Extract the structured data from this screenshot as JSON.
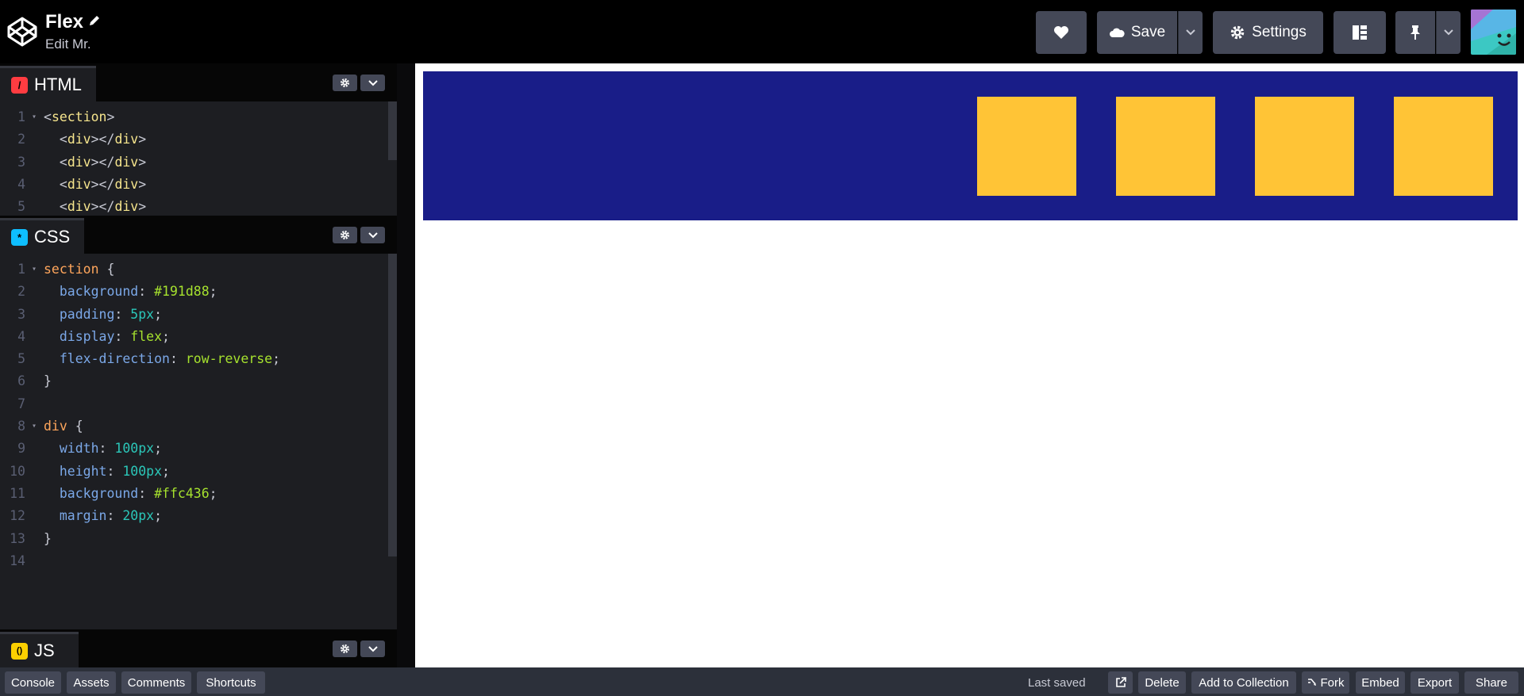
{
  "header": {
    "title": "Flex",
    "subtitle": "Edit Mr.",
    "save_label": "Save",
    "settings_label": "Settings"
  },
  "panels": {
    "html": {
      "label": "HTML",
      "badge": "/",
      "badge_color": "#ff3c41"
    },
    "css": {
      "label": "CSS",
      "badge": "*",
      "badge_color": "#0ebeff"
    },
    "js": {
      "label": "JS",
      "badge": "()",
      "badge_color": "#fcd000"
    }
  },
  "html_code": [
    {
      "n": "1",
      "fold": true,
      "parts": [
        [
          "t-ang",
          "<"
        ],
        [
          "t-tag",
          "section"
        ],
        [
          "t-ang",
          ">"
        ]
      ]
    },
    {
      "n": "2",
      "fold": false,
      "parts": [
        [
          "t-ang",
          "  <"
        ],
        [
          "t-tag",
          "div"
        ],
        [
          "t-ang",
          "></"
        ],
        [
          "t-tag",
          "div"
        ],
        [
          "t-ang",
          ">"
        ]
      ]
    },
    {
      "n": "3",
      "fold": false,
      "parts": [
        [
          "t-ang",
          "  <"
        ],
        [
          "t-tag",
          "div"
        ],
        [
          "t-ang",
          "></"
        ],
        [
          "t-tag",
          "div"
        ],
        [
          "t-ang",
          ">"
        ]
      ]
    },
    {
      "n": "4",
      "fold": false,
      "parts": [
        [
          "t-ang",
          "  <"
        ],
        [
          "t-tag",
          "div"
        ],
        [
          "t-ang",
          "></"
        ],
        [
          "t-tag",
          "div"
        ],
        [
          "t-ang",
          ">"
        ]
      ]
    },
    {
      "n": "5",
      "fold": false,
      "parts": [
        [
          "t-ang",
          "  <"
        ],
        [
          "t-tag",
          "div"
        ],
        [
          "t-ang",
          "></"
        ],
        [
          "t-tag",
          "div"
        ],
        [
          "t-ang",
          ">"
        ]
      ]
    }
  ],
  "css_code": [
    {
      "n": "1",
      "fold": true,
      "parts": [
        [
          "t-sel",
          "section"
        ],
        [
          "t-ang",
          " {"
        ]
      ]
    },
    {
      "n": "2",
      "fold": false,
      "parts": [
        [
          "t-prop",
          "  background"
        ],
        [
          "t-ang",
          ": "
        ],
        [
          "t-val",
          "#191d88"
        ],
        [
          "t-ang",
          ";"
        ]
      ]
    },
    {
      "n": "3",
      "fold": false,
      "parts": [
        [
          "t-prop",
          "  padding"
        ],
        [
          "t-ang",
          ": "
        ],
        [
          "t-num",
          "5px"
        ],
        [
          "t-ang",
          ";"
        ]
      ]
    },
    {
      "n": "4",
      "fold": false,
      "parts": [
        [
          "t-prop",
          "  display"
        ],
        [
          "t-ang",
          ": "
        ],
        [
          "t-val",
          "flex"
        ],
        [
          "t-ang",
          ";"
        ]
      ]
    },
    {
      "n": "5",
      "fold": false,
      "parts": [
        [
          "t-prop",
          "  flex-direction"
        ],
        [
          "t-ang",
          ": "
        ],
        [
          "t-val",
          "row-reverse"
        ],
        [
          "t-ang",
          ";"
        ]
      ]
    },
    {
      "n": "6",
      "fold": false,
      "parts": [
        [
          "t-ang",
          "}"
        ]
      ]
    },
    {
      "n": "7",
      "fold": false,
      "parts": []
    },
    {
      "n": "8",
      "fold": true,
      "parts": [
        [
          "t-sel",
          "div"
        ],
        [
          "t-ang",
          " {"
        ]
      ]
    },
    {
      "n": "9",
      "fold": false,
      "parts": [
        [
          "t-prop",
          "  width"
        ],
        [
          "t-ang",
          ": "
        ],
        [
          "t-num",
          "100px"
        ],
        [
          "t-ang",
          ";"
        ]
      ]
    },
    {
      "n": "10",
      "fold": false,
      "parts": [
        [
          "t-prop",
          "  height"
        ],
        [
          "t-ang",
          ": "
        ],
        [
          "t-num",
          "100px"
        ],
        [
          "t-ang",
          ";"
        ]
      ]
    },
    {
      "n": "11",
      "fold": false,
      "parts": [
        [
          "t-prop",
          "  background"
        ],
        [
          "t-ang",
          ": "
        ],
        [
          "t-val",
          "#ffc436"
        ],
        [
          "t-ang",
          ";"
        ]
      ]
    },
    {
      "n": "12",
      "fold": false,
      "parts": [
        [
          "t-prop",
          "  margin"
        ],
        [
          "t-ang",
          ": "
        ],
        [
          "t-num",
          "20px"
        ],
        [
          "t-ang",
          ";"
        ]
      ]
    },
    {
      "n": "13",
      "fold": false,
      "parts": [
        [
          "t-ang",
          "}"
        ]
      ]
    },
    {
      "n": "14",
      "fold": false,
      "parts": []
    }
  ],
  "preview": {
    "section_color": "#191d88",
    "box_color": "#ffc436",
    "box_count": 4
  },
  "footer": {
    "left_buttons": [
      "Console",
      "Assets",
      "Comments",
      "Shortcuts"
    ],
    "last_saved": "Last saved",
    "delete_label": "Delete",
    "add_collection_label": "Add to Collection",
    "fork_label": "Fork",
    "embed_label": "Embed",
    "export_label": "Export",
    "share_label": "Share"
  },
  "icons": {
    "logo": "codepen-logo-icon",
    "edit": "pencil-icon",
    "heart": "heart-icon",
    "cloud": "cloud-icon",
    "gear": "gear-icon",
    "layout": "layout-icon",
    "pin": "pin-icon",
    "chevron": "chevron-down-icon",
    "external": "external-link-icon"
  }
}
